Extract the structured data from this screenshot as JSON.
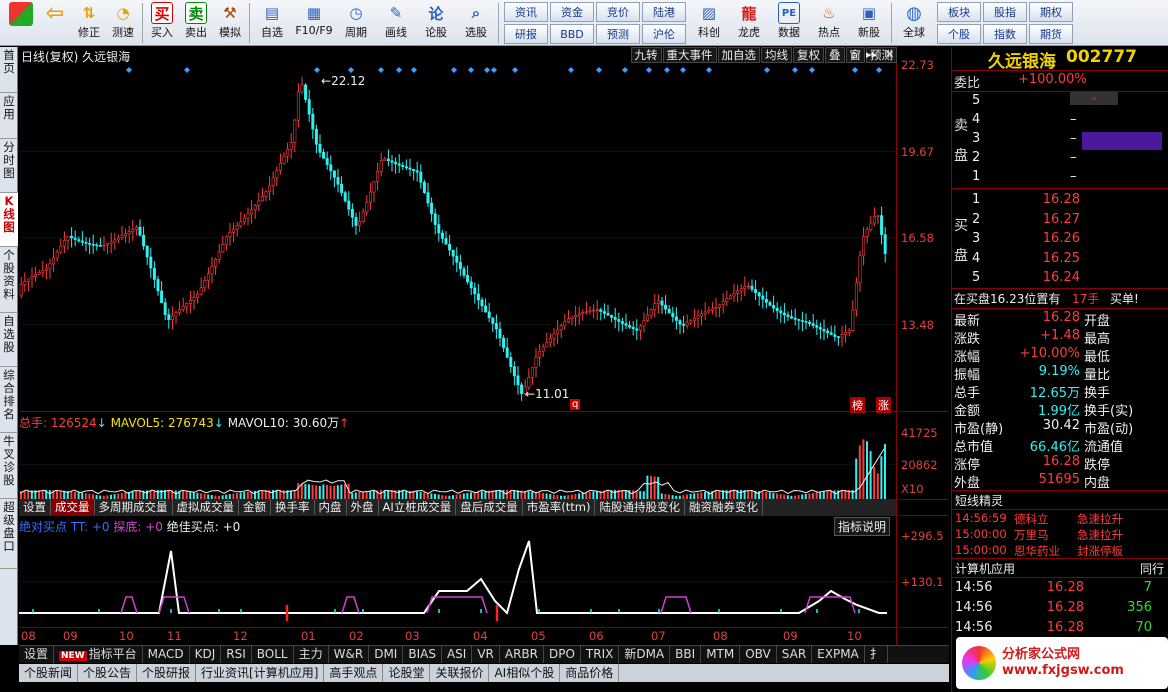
{
  "toolbar": {
    "buttons": [
      "修正",
      "测速",
      "买入",
      "卖出",
      "模拟",
      "自选",
      "F10/F9",
      "周期",
      "画线",
      "论股",
      "选股"
    ],
    "grid": [
      "资讯",
      "资金",
      "研报",
      "BBD",
      "竞价",
      "预测",
      "陆港",
      "沪伦"
    ],
    "icons": [
      "科创",
      "龙虎",
      "数据",
      "热点",
      "新股"
    ],
    "right": [
      "全球",
      "板块",
      "股指",
      "期权",
      "个股",
      "指数",
      "期货"
    ]
  },
  "left_tabs": [
    "首页",
    "应用",
    "分时图",
    "K线图",
    "个股资料",
    "自选股",
    "综合排名",
    "牛叉诊股",
    "超级盘口"
  ],
  "chart": {
    "header_left": "日线(复权) 久远银海",
    "tools": [
      "九转",
      "重大事件",
      "加自选",
      "均线",
      "复权",
      "叠",
      "窗",
      "预测"
    ],
    "y_labels": [
      "22.73",
      "19.67",
      "16.58",
      "13.48"
    ],
    "high_label": "22.12",
    "low_label": "11.01",
    "marker_q": "q",
    "marker_bang": "榜",
    "marker_zhang": "涨"
  },
  "volume": {
    "title": "总手: 126524",
    "mavol5": "MAVOL5: 276743",
    "mavol10": "MAVOL10: 30.60万",
    "y_labels": [
      "41725",
      "20862"
    ],
    "unit": "X10",
    "tabs": [
      "设置",
      "成交量",
      "多周期成交量",
      "虚拟成交量",
      "金额",
      "换手率",
      "内盘",
      "外盘",
      "AI立桩成交量",
      "盘后成交量",
      "市盈率(ttm)",
      "陆股通持股变化",
      "融资融券变化"
    ]
  },
  "indicator": {
    "title_parts": [
      "绝对买点",
      "TT: +0",
      "探底: +0",
      "绝佳买点: +0"
    ],
    "button": "指标说明",
    "y_labels": [
      "+296.5",
      "+130.1"
    ]
  },
  "x_axis": [
    "08",
    "09",
    "10",
    "11",
    "12",
    "01",
    "02",
    "03",
    "04",
    "05",
    "06",
    "07",
    "08",
    "09",
    "10"
  ],
  "indicator_bar": [
    "设置",
    "指标平台",
    "MACD",
    "KDJ",
    "RSI",
    "BOLL",
    "主力",
    "W&R",
    "DMI",
    "BIAS",
    "ASI",
    "VR",
    "ARBR",
    "DPO",
    "TRIX",
    "新DMA",
    "BBI",
    "MTM",
    "OBV",
    "SAR",
    "EXPMA",
    "扌"
  ],
  "new_badge": "NEW",
  "news_bar": [
    "个股新闻",
    "个股公告",
    "个股研报",
    "行业资讯[计算机应用]",
    "高手观点",
    "论股堂",
    "关联报价",
    "AI相似个股",
    "商品价格"
  ],
  "stock": {
    "name": "久远银海",
    "code": "002777"
  },
  "order_book": {
    "weibi_label": "委比",
    "weibi": "+100.00%",
    "sell_label": "卖盘",
    "buy_label": "买盘",
    "sell": [
      {
        "lvl": "5",
        "price": "",
        "vol": ""
      },
      {
        "lvl": "4",
        "price": "",
        "vol": "–"
      },
      {
        "lvl": "3",
        "price": "",
        "vol": "–"
      },
      {
        "lvl": "2",
        "price": "",
        "vol": "–"
      },
      {
        "lvl": "1",
        "price": "",
        "vol": "–"
      }
    ],
    "buy": [
      {
        "lvl": "1",
        "price": "16.28"
      },
      {
        "lvl": "2",
        "price": "16.27"
      },
      {
        "lvl": "3",
        "price": "16.26"
      },
      {
        "lvl": "4",
        "price": "16.25"
      },
      {
        "lvl": "5",
        "price": "16.24"
      }
    ]
  },
  "notice": {
    "text": "在买盘16.23位置有",
    "vol": "17手",
    "tag": "买单!"
  },
  "quote": [
    {
      "l": "最新",
      "v": "16.28",
      "c": "red",
      "r": "开盘"
    },
    {
      "l": "涨跌",
      "v": "+1.48",
      "c": "red",
      "r": "最高"
    },
    {
      "l": "涨幅",
      "v": "+10.00%",
      "c": "red",
      "r": "最低"
    },
    {
      "l": "振幅",
      "v": "9.19%",
      "c": "cyan",
      "r": "量比"
    },
    {
      "l": "总手",
      "v": "12.65万",
      "c": "cyan",
      "r": "换手"
    },
    {
      "l": "金额",
      "v": "1.99亿",
      "c": "cyan",
      "r": "换手(实)"
    },
    {
      "l": "市盈(静)",
      "v": "30.42",
      "c": "white",
      "r": "市盈(动)"
    },
    {
      "l": "总市值",
      "v": "66.46亿",
      "c": "cyan",
      "r": "流通值"
    },
    {
      "l": "涨停",
      "v": "16.28",
      "c": "red",
      "r": "跌停"
    },
    {
      "l": "外盘",
      "v": "51695",
      "c": "red",
      "r": "内盘"
    }
  ],
  "short_elf": {
    "title": "短线精灵",
    "rows": [
      {
        "t": "14:56:59",
        "s": "德科立",
        "e": "急速拉升"
      },
      {
        "t": "15:00:00",
        "s": "万里马",
        "e": "急速拉升"
      },
      {
        "t": "15:00:00",
        "s": "恩华药业",
        "e": "封涨停板"
      }
    ]
  },
  "industry": {
    "name": "计算机应用",
    "tab": "同行"
  },
  "ticks": [
    {
      "t": "14:56",
      "p": "16.28",
      "v": "7"
    },
    {
      "t": "14:56",
      "p": "16.28",
      "v": "356"
    },
    {
      "t": "14:56",
      "p": "16.28",
      "v": "70"
    }
  ],
  "watermark": "分析家公式网 www.fxjgsw.com",
  "colors": {
    "up": "#ff3b3b",
    "down": "#2ef2f2",
    "axis": "#e04040"
  }
}
